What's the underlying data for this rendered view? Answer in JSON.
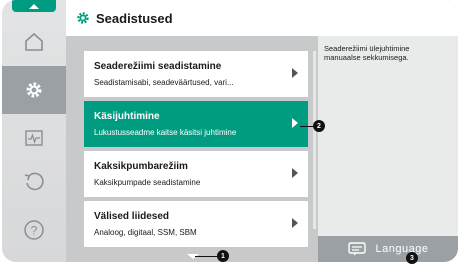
{
  "header": {
    "title": "Seadistused",
    "icon": "gear-icon"
  },
  "rail": {
    "items": [
      {
        "icon": "home-icon"
      },
      {
        "icon": "gear-icon",
        "active": true
      },
      {
        "icon": "pulse-monitor-icon"
      },
      {
        "icon": "restore-icon"
      },
      {
        "icon": "help-icon"
      }
    ]
  },
  "menu": {
    "items": [
      {
        "title": "Seaderežiimi seadistamine",
        "subtitle": "Seadistamisabi, seadeväärtused, vari..."
      },
      {
        "title": "Käsijuhtimine",
        "subtitle": "Lukustusseadme kaitse käsitsi juhtimine",
        "active": true
      },
      {
        "title": "Kaksikpumbarežiim",
        "subtitle": "Kaksikpumpade seadistamine"
      },
      {
        "title": "Välised liidesed",
        "subtitle": "Analoog, digitaal, SSM, SBM"
      }
    ]
  },
  "help": {
    "text": "Seaderežiimi ülejuhtimine manuaalse sekkumisega."
  },
  "language": {
    "label": "Language",
    "icon": "chat-bubble-icon"
  },
  "callouts": [
    "1",
    "2",
    "3"
  ],
  "colors": {
    "accent": "#009c82",
    "panel": "#c7c9ca",
    "rail_active": "#9aa0a3"
  }
}
